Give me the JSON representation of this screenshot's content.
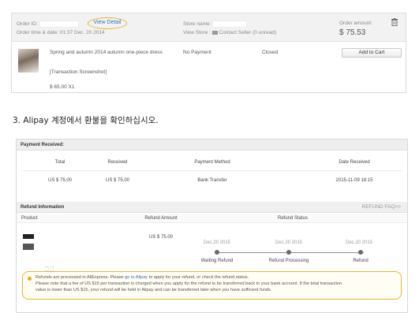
{
  "order": {
    "order_id_label": "Order ID:",
    "order_time_label": "Order time & date:",
    "order_time_value": "01:37 Dec. 20 2014",
    "view_detail": "View Detail",
    "store_name_label": "Store name:",
    "view_store": "View Store",
    "contact_seller": "Contact Seller (0 unread)",
    "amount_label": "Order amount:",
    "amount_value": "$ 75.53",
    "product_title": "Spring and autumn 2014 autumn one-piece dress",
    "transaction_screenshot": "[Transaction Screenshot]",
    "product_price": "$ 65.00 X1",
    "payment_status": "No Payment",
    "order_status": "Closed",
    "add_to_cart": "Add to Cart"
  },
  "instruction": "3. Alipay 계정에서 환불을 확인하십시오.",
  "payment": {
    "title": "Payment Received:",
    "headers": [
      "Total",
      "Received",
      "Payment Method",
      "Date Received"
    ],
    "row": [
      "US $ 75.00",
      "US $ 75.00",
      "Bank Transfer",
      "2015-11-09 18:15"
    ]
  },
  "refund": {
    "title": "Refund Information",
    "faq": "REFUND FAQ>>",
    "headers": [
      "Product",
      "Refund Amount",
      "Refund Status"
    ],
    "amount": "US $ 75.00",
    "steps": [
      {
        "date": "Dec.20 2015",
        "label": "Waiting Refund"
      },
      {
        "date": "Dec.20 2015",
        "label": "Refund Processing"
      },
      {
        "date": "Dec.20 2015",
        "label": "Refund"
      }
    ],
    "note_line1_a": "Refunds are processed in AliExpress. Please ",
    "note_line1_link": "go to Alipay",
    "note_line1_b": " to apply for your refund, or check the refund status.",
    "note_line2": "Please note that a fee of US $15 per transaction is charged when you apply for the refund to be transferred back to your bank account. If the total transaction",
    "note_line3": "value is lower than US $15, your refund will be held in Alipay and can be transferred later when you have sufficient funds."
  },
  "colors": {
    "highlight": "#e8b52b",
    "link": "#3a6fc2"
  }
}
